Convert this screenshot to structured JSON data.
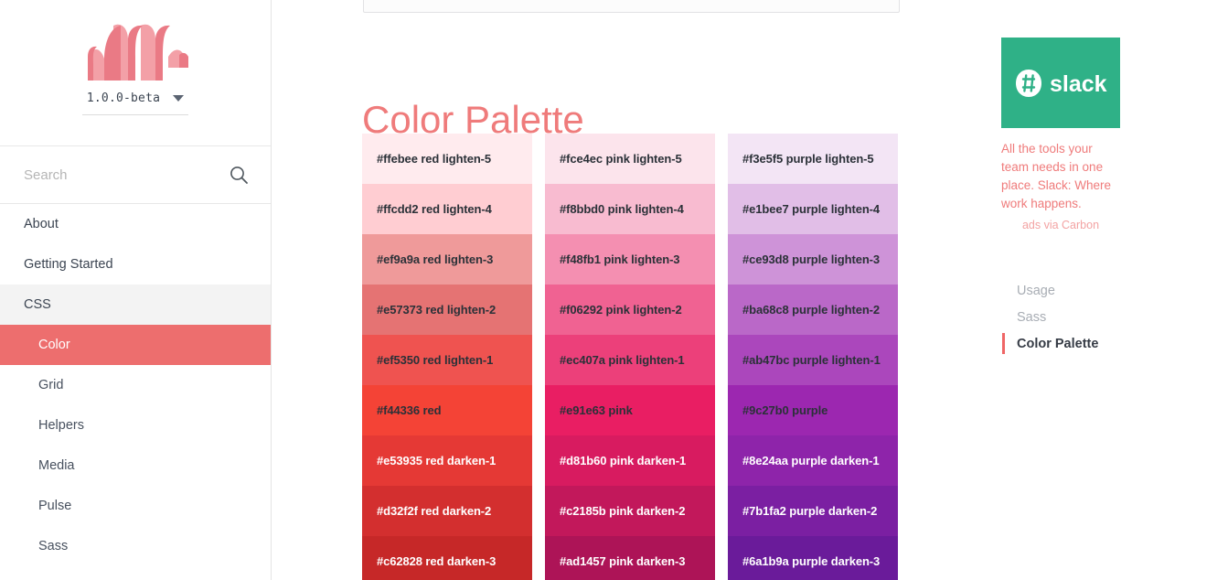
{
  "sidebar": {
    "logo_name": "materialize-m-logo",
    "logo_colors": {
      "light": "#f3a0a7",
      "dark": "#ea7a85"
    },
    "version": "1.0.0-beta",
    "version_caret_icon": "chevron-down-icon",
    "search": {
      "placeholder": "Search",
      "value": "",
      "icon": "search-icon"
    },
    "items": [
      {
        "label": "About",
        "level": "top",
        "state": "normal"
      },
      {
        "label": "Getting Started",
        "level": "top",
        "state": "normal"
      },
      {
        "label": "CSS",
        "level": "top",
        "state": "open"
      },
      {
        "label": "Color",
        "level": "sub",
        "state": "active"
      },
      {
        "label": "Grid",
        "level": "sub",
        "state": "normal"
      },
      {
        "label": "Helpers",
        "level": "sub",
        "state": "normal"
      },
      {
        "label": "Media",
        "level": "sub",
        "state": "normal"
      },
      {
        "label": "Pulse",
        "level": "sub",
        "state": "normal"
      },
      {
        "label": "Sass",
        "level": "sub",
        "state": "normal"
      }
    ],
    "active_color": "#ed6e6e",
    "open_section_bg": "#f3f3f3"
  },
  "main": {
    "title": "Color Palette",
    "title_color": "#ef7b7b",
    "palette_columns": [
      {
        "name": "red",
        "swatches": [
          {
            "label": "#ffebee red lighten-5",
            "bg": "#ffebee",
            "fg": "#2b3138"
          },
          {
            "label": "#ffcdd2 red lighten-4",
            "bg": "#ffcdd2",
            "fg": "#2b3138"
          },
          {
            "label": "#ef9a9a red lighten-3",
            "bg": "#ef9a9a",
            "fg": "#2b3138"
          },
          {
            "label": "#e57373 red lighten-2",
            "bg": "#e57373",
            "fg": "#2b3138"
          },
          {
            "label": "#ef5350 red lighten-1",
            "bg": "#ef5350",
            "fg": "#2b3138"
          },
          {
            "label": "#f44336 red",
            "bg": "#f44336",
            "fg": "#2b3138"
          },
          {
            "label": "#e53935 red darken-1",
            "bg": "#e53935",
            "fg": "#ffffff"
          },
          {
            "label": "#d32f2f red darken-2",
            "bg": "#d32f2f",
            "fg": "#ffffff"
          },
          {
            "label": "#c62828 red darken-3",
            "bg": "#c62828",
            "fg": "#ffffff"
          }
        ]
      },
      {
        "name": "pink",
        "swatches": [
          {
            "label": "#fce4ec pink lighten-5",
            "bg": "#fce4ec",
            "fg": "#2b3138"
          },
          {
            "label": "#f8bbd0 pink lighten-4",
            "bg": "#f8bbd0",
            "fg": "#2b3138"
          },
          {
            "label": "#f48fb1 pink lighten-3",
            "bg": "#f48fb1",
            "fg": "#2b3138"
          },
          {
            "label": "#f06292 pink lighten-2",
            "bg": "#f06292",
            "fg": "#2b3138"
          },
          {
            "label": "#ec407a pink lighten-1",
            "bg": "#ec407a",
            "fg": "#2b3138"
          },
          {
            "label": "#e91e63 pink",
            "bg": "#e91e63",
            "fg": "#2b3138"
          },
          {
            "label": "#d81b60 pink darken-1",
            "bg": "#d81b60",
            "fg": "#ffffff"
          },
          {
            "label": "#c2185b pink darken-2",
            "bg": "#c2185b",
            "fg": "#ffffff"
          },
          {
            "label": "#ad1457 pink darken-3",
            "bg": "#ad1457",
            "fg": "#ffffff"
          }
        ]
      },
      {
        "name": "purple",
        "swatches": [
          {
            "label": "#f3e5f5 purple lighten-5",
            "bg": "#f3e5f5",
            "fg": "#2b3138"
          },
          {
            "label": "#e1bee7 purple lighten-4",
            "bg": "#e1bee7",
            "fg": "#2b3138"
          },
          {
            "label": "#ce93d8 purple lighten-3",
            "bg": "#ce93d8",
            "fg": "#2b3138"
          },
          {
            "label": "#ba68c8 purple lighten-2",
            "bg": "#ba68c8",
            "fg": "#2b3138"
          },
          {
            "label": "#ab47bc purple lighten-1",
            "bg": "#ab47bc",
            "fg": "#2b3138"
          },
          {
            "label": "#9c27b0 purple",
            "bg": "#9c27b0",
            "fg": "#2b3138"
          },
          {
            "label": "#8e24aa purple darken-1",
            "bg": "#8e24aa",
            "fg": "#ffffff"
          },
          {
            "label": "#7b1fa2 purple darken-2",
            "bg": "#7b1fa2",
            "fg": "#ffffff"
          },
          {
            "label": "#6a1b9a purple darken-3",
            "bg": "#6a1b9a",
            "fg": "#ffffff"
          }
        ]
      }
    ]
  },
  "right_rail": {
    "ad": {
      "banner_icon": "slack-logo",
      "banner_bg": "#2fb187",
      "brand": "slack",
      "text": "All the tools your team needs in one place. Slack: Where work happens.",
      "credit": "ads via Carbon",
      "text_color": "#ef7b7b"
    },
    "toc": [
      {
        "label": "Usage",
        "active": false
      },
      {
        "label": "Sass",
        "active": false
      },
      {
        "label": "Color Palette",
        "active": true
      }
    ],
    "toc_marker_color": "#ef6666"
  }
}
